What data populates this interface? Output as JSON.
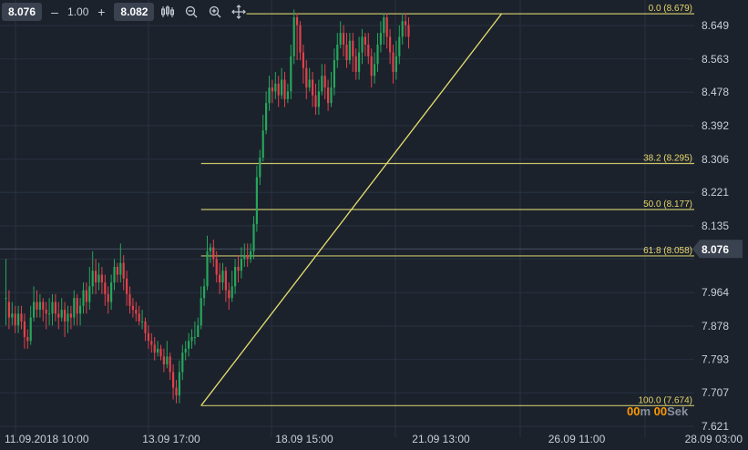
{
  "toolbar": {
    "bid": "8.076",
    "minus_label": "–",
    "spread": "1.00",
    "plus_label": "+",
    "ask": "8.082",
    "icons": [
      "candles-icon",
      "zoom-out-icon",
      "zoom-in-icon",
      "crosshair-icon"
    ]
  },
  "countdown": {
    "minutes": "00",
    "minutes_unit": "m",
    "seconds": "00",
    "seconds_unit": "Sek"
  },
  "colors": {
    "background": "#1b222c",
    "grid": "#283140",
    "bull": "#26a65b",
    "bear": "#e0414a",
    "fib": "#c9c26a",
    "fib_text": "#e8d66a",
    "axis_text": "#c9cfd8",
    "price_tag": "#3a4250"
  },
  "chart_data": {
    "type": "candlestick",
    "y_ticks": [
      8.649,
      8.563,
      8.478,
      8.392,
      8.306,
      8.221,
      8.135,
      8.05,
      7.964,
      7.878,
      7.793,
      7.707,
      7.621
    ],
    "ylim": [
      7.621,
      8.679
    ],
    "x_ticks": [
      "11.09.2018 10:00",
      "13.09 17:00",
      "18.09 15:00",
      "21.09 13:00",
      "26.09 11:00",
      "28.09 03:00"
    ],
    "current_price": "8.076",
    "fibonacci": {
      "levels": [
        {
          "label": "0.0 (8.679)",
          "value": 8.679
        },
        {
          "label": "38.2 (8.295)",
          "value": 8.295
        },
        {
          "label": "50.0 (8.177)",
          "value": 8.177
        },
        {
          "label": "61.8 (8.058)",
          "value": 8.058
        },
        {
          "label": "100.0 (7.674)",
          "value": 7.674
        }
      ],
      "trend_start": {
        "bar": 63,
        "price": 7.674
      },
      "trend_end": {
        "bar": 160,
        "price": 8.679
      }
    },
    "candles": [
      [
        7.95,
        7.95,
        8.05,
        7.88
      ],
      [
        7.94,
        7.9,
        7.97,
        7.87
      ],
      [
        7.9,
        7.91,
        7.94,
        7.88
      ],
      [
        7.91,
        7.88,
        7.93,
        7.86
      ],
      [
        7.88,
        7.91,
        7.93,
        7.86
      ],
      [
        7.91,
        7.89,
        7.93,
        7.87
      ],
      [
        7.89,
        7.85,
        7.91,
        7.82
      ],
      [
        7.85,
        7.84,
        7.87,
        7.82
      ],
      [
        7.84,
        7.9,
        7.93,
        7.83
      ],
      [
        7.9,
        7.94,
        7.98,
        7.89
      ],
      [
        7.94,
        7.92,
        7.97,
        7.9
      ],
      [
        7.92,
        7.94,
        7.96,
        7.9
      ],
      [
        7.94,
        7.92,
        7.95,
        7.89
      ],
      [
        7.92,
        7.91,
        7.94,
        7.87
      ],
      [
        7.91,
        7.91,
        7.95,
        7.88
      ],
      [
        7.91,
        7.94,
        7.96,
        7.88
      ],
      [
        7.94,
        7.91,
        7.96,
        7.89
      ],
      [
        7.91,
        7.9,
        7.94,
        7.87
      ],
      [
        7.9,
        7.92,
        7.95,
        7.89
      ],
      [
        7.92,
        7.89,
        7.94,
        7.85
      ],
      [
        7.89,
        7.91,
        7.93,
        7.86
      ],
      [
        7.91,
        7.9,
        7.93,
        7.87
      ],
      [
        7.9,
        7.95,
        7.97,
        7.88
      ],
      [
        7.95,
        7.91,
        7.96,
        7.88
      ],
      [
        7.91,
        7.93,
        7.95,
        7.88
      ],
      [
        7.93,
        7.97,
        7.99,
        7.91
      ],
      [
        7.97,
        7.94,
        7.99,
        7.91
      ],
      [
        7.94,
        7.98,
        8.03,
        7.92
      ],
      [
        7.98,
        8.02,
        8.07,
        7.96
      ],
      [
        8.02,
        7.99,
        8.05,
        7.96
      ],
      [
        7.99,
        8.01,
        8.04,
        7.97
      ],
      [
        8.01,
        7.99,
        8.03,
        7.96
      ],
      [
        7.99,
        7.96,
        8.01,
        7.93
      ],
      [
        7.96,
        7.94,
        7.98,
        7.91
      ],
      [
        7.94,
        7.99,
        8.01,
        7.92
      ],
      [
        7.99,
        8.03,
        8.05,
        7.97
      ],
      [
        8.03,
        8.01,
        8.04,
        7.99
      ],
      [
        8.01,
        8.04,
        8.09,
        7.99
      ],
      [
        8.04,
        8.0,
        8.06,
        7.97
      ],
      [
        8.0,
        7.96,
        8.02,
        7.93
      ],
      [
        7.96,
        7.93,
        7.98,
        7.91
      ],
      [
        7.93,
        7.92,
        7.95,
        7.9
      ],
      [
        7.92,
        7.91,
        7.94,
        7.89
      ],
      [
        7.91,
        7.89,
        7.93,
        7.88
      ],
      [
        7.89,
        7.89,
        7.92,
        7.87
      ],
      [
        7.89,
        7.86,
        7.9,
        7.84
      ],
      [
        7.86,
        7.84,
        7.88,
        7.82
      ],
      [
        7.84,
        7.83,
        7.86,
        7.81
      ],
      [
        7.83,
        7.81,
        7.85,
        7.79
      ],
      [
        7.81,
        7.82,
        7.84,
        7.8
      ],
      [
        7.82,
        7.8,
        7.83,
        7.79
      ],
      [
        7.8,
        7.78,
        7.82,
        7.76
      ],
      [
        7.78,
        7.8,
        7.84,
        7.77
      ],
      [
        7.8,
        7.76,
        7.81,
        7.74
      ],
      [
        7.76,
        7.72,
        7.78,
        7.69
      ],
      [
        7.72,
        7.7,
        7.74,
        7.68
      ],
      [
        7.7,
        7.76,
        7.79,
        7.68
      ],
      [
        7.76,
        7.81,
        7.83,
        7.74
      ],
      [
        7.81,
        7.82,
        7.84,
        7.79
      ],
      [
        7.82,
        7.84,
        7.86,
        7.8
      ],
      [
        7.84,
        7.85,
        7.87,
        7.82
      ],
      [
        7.85,
        7.85,
        7.89,
        7.83
      ],
      [
        7.85,
        7.88,
        7.9,
        7.85
      ],
      [
        7.88,
        7.95,
        7.98,
        7.87
      ],
      [
        7.95,
        7.98,
        8.0,
        7.93
      ],
      [
        7.98,
        8.07,
        8.11,
        7.97
      ],
      [
        8.07,
        8.08,
        8.09,
        8.04
      ],
      [
        8.08,
        8.05,
        8.1,
        8.03
      ],
      [
        8.05,
        8.01,
        8.07,
        7.99
      ],
      [
        8.01,
        7.99,
        8.04,
        7.96
      ],
      [
        7.99,
        8.02,
        8.04,
        7.97
      ],
      [
        8.02,
        7.97,
        8.03,
        7.94
      ],
      [
        7.97,
        7.95,
        7.99,
        7.92
      ],
      [
        7.95,
        7.98,
        8.02,
        7.94
      ],
      [
        7.98,
        8.03,
        8.05,
        7.96
      ],
      [
        8.03,
        8.02,
        8.06,
        7.99
      ],
      [
        8.02,
        8.05,
        8.08,
        8.0
      ],
      [
        8.05,
        8.06,
        8.09,
        8.03
      ],
      [
        8.06,
        8.05,
        8.09,
        8.03
      ],
      [
        8.05,
        8.07,
        8.09,
        8.04
      ],
      [
        8.07,
        8.14,
        8.16,
        8.05
      ],
      [
        8.14,
        8.26,
        8.29,
        8.12
      ],
      [
        8.26,
        8.31,
        8.33,
        8.24
      ],
      [
        8.31,
        8.38,
        8.42,
        8.3
      ],
      [
        8.38,
        8.45,
        8.48,
        8.37
      ],
      [
        8.45,
        8.49,
        8.52,
        8.43
      ],
      [
        8.49,
        8.48,
        8.51,
        8.45
      ],
      [
        8.48,
        8.5,
        8.53,
        8.46
      ],
      [
        8.5,
        8.47,
        8.52,
        8.44
      ],
      [
        8.47,
        8.51,
        8.54,
        8.46
      ],
      [
        8.51,
        8.46,
        8.53,
        8.44
      ],
      [
        8.46,
        8.48,
        8.5,
        8.45
      ],
      [
        8.48,
        8.57,
        8.6,
        8.46
      ],
      [
        8.57,
        8.67,
        8.69,
        8.55
      ],
      [
        8.67,
        8.65,
        8.68,
        8.56
      ],
      [
        8.65,
        8.58,
        8.66,
        8.56
      ],
      [
        8.58,
        8.54,
        8.6,
        8.5
      ],
      [
        8.54,
        8.49,
        8.56,
        8.46
      ],
      [
        8.49,
        8.51,
        8.54,
        8.48
      ],
      [
        8.51,
        8.47,
        8.53,
        8.44
      ],
      [
        8.47,
        8.44,
        8.5,
        8.42
      ],
      [
        8.44,
        8.48,
        8.51,
        8.42
      ],
      [
        8.48,
        8.52,
        8.55,
        8.47
      ],
      [
        8.52,
        8.49,
        8.55,
        8.46
      ],
      [
        8.49,
        8.45,
        8.51,
        8.43
      ],
      [
        8.45,
        8.49,
        8.53,
        8.44
      ],
      [
        8.49,
        8.56,
        8.59,
        8.47
      ],
      [
        8.56,
        8.6,
        8.63,
        8.54
      ],
      [
        8.6,
        8.63,
        8.66,
        8.59
      ],
      [
        8.63,
        8.6,
        8.65,
        8.57
      ],
      [
        8.6,
        8.56,
        8.63,
        8.54
      ],
      [
        8.56,
        8.61,
        8.63,
        8.55
      ],
      [
        8.61,
        8.57,
        8.63,
        8.53
      ],
      [
        8.57,
        8.53,
        8.59,
        8.51
      ],
      [
        8.53,
        8.58,
        8.62,
        8.51
      ],
      [
        8.58,
        8.62,
        8.64,
        8.55
      ],
      [
        8.62,
        8.6,
        8.63,
        8.57
      ],
      [
        8.6,
        8.57,
        8.63,
        8.55
      ],
      [
        8.57,
        8.52,
        8.59,
        8.49
      ],
      [
        8.52,
        8.55,
        8.58,
        8.5
      ],
      [
        8.55,
        8.6,
        8.63,
        8.53
      ],
      [
        8.6,
        8.63,
        8.66,
        8.58
      ],
      [
        8.63,
        8.67,
        8.68,
        8.6
      ],
      [
        8.67,
        8.62,
        8.68,
        8.59
      ],
      [
        8.62,
        8.58,
        8.64,
        8.55
      ],
      [
        8.58,
        8.53,
        8.6,
        8.5
      ],
      [
        8.53,
        8.57,
        8.61,
        8.51
      ],
      [
        8.57,
        8.62,
        8.65,
        8.55
      ],
      [
        8.62,
        8.66,
        8.68,
        8.6
      ],
      [
        8.66,
        8.65,
        8.68,
        8.62
      ],
      [
        8.65,
        8.62,
        8.67,
        8.59
      ]
    ]
  }
}
